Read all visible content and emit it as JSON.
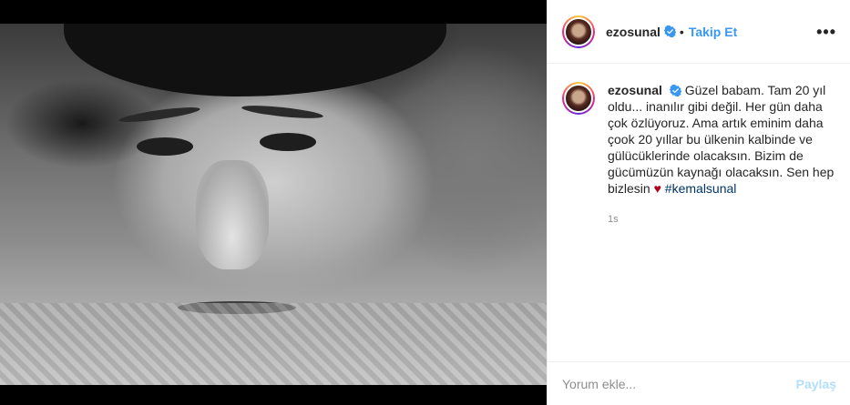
{
  "post": {
    "username": "ezosunal",
    "follow_label": "Takip Et",
    "separator": "•",
    "more_label": "•••"
  },
  "caption": {
    "username": "ezosunal",
    "text": "Güzel babam. Tam 20 yıl oldu... inanılır gibi değil. Her gün daha çok özlüyoruz. Ama artık eminim daha çook 20 yıllar bu ülkenin kalbinde ve gülücüklerinde olacaksın. Bizim de gücümüzün kaynağı olacaksın. Sen hep bizlesin",
    "heart": "♥",
    "hashtag": "#kemalsunal",
    "time": "1s"
  },
  "comment_box": {
    "placeholder": "Yorum ekle...",
    "share_label": "Paylaş"
  },
  "colors": {
    "link": "#3897f0",
    "share_disabled": "#b2dffc",
    "hashtag": "#003569",
    "heart": "#b3001b"
  },
  "icons": {
    "verified": "verified-badge-icon",
    "more": "more-options-icon"
  }
}
